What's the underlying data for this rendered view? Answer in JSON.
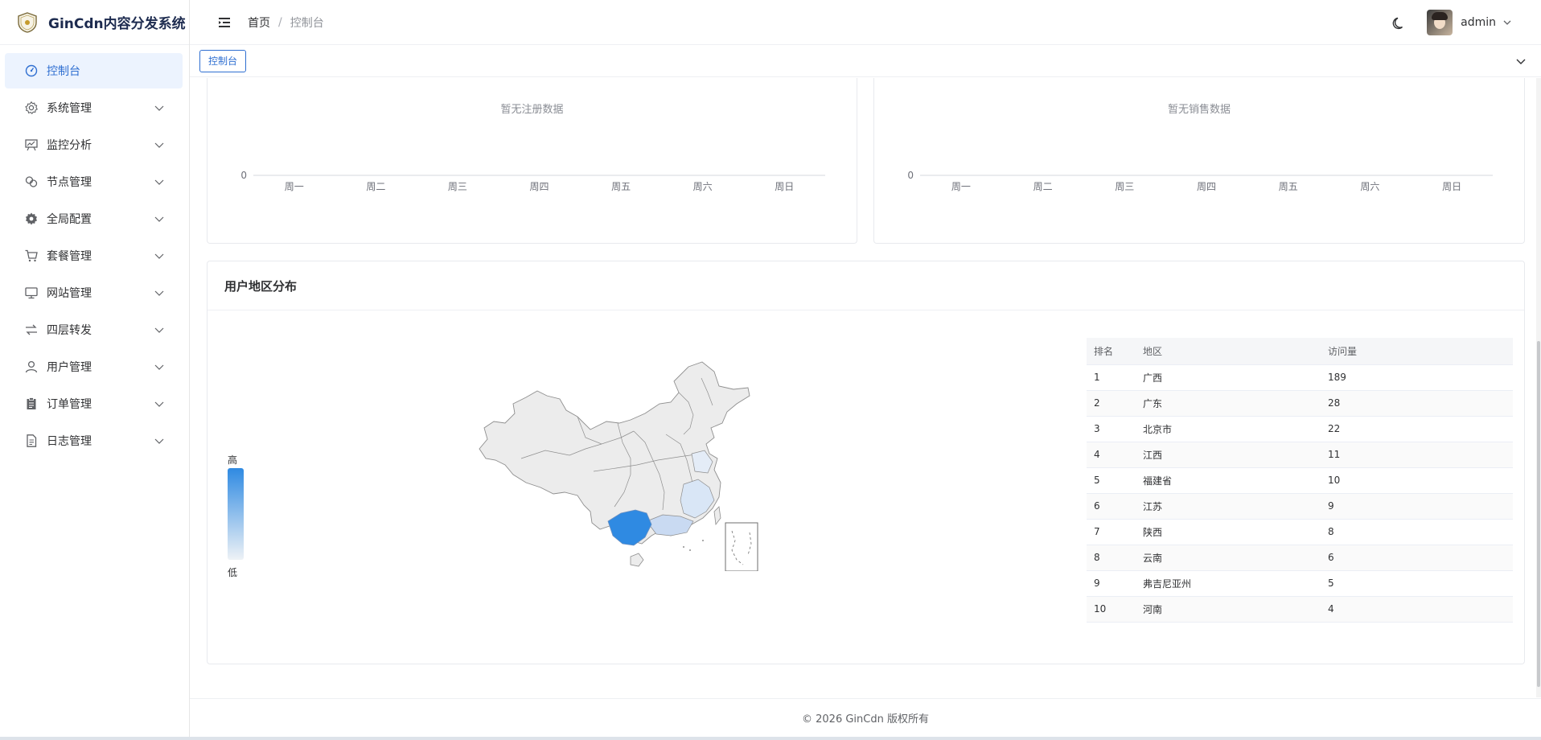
{
  "app": {
    "title": "GinCdn内容分发系统"
  },
  "sidebar": {
    "items": [
      {
        "label": "控制台",
        "icon": "dashboard-icon",
        "active": true
      },
      {
        "label": "系统管理",
        "icon": "gear-icon"
      },
      {
        "label": "监控分析",
        "icon": "presentation-chart-icon"
      },
      {
        "label": "节点管理",
        "icon": "link-icon"
      },
      {
        "label": "全局配置",
        "icon": "gear-filled-icon"
      },
      {
        "label": "套餐管理",
        "icon": "cart-icon"
      },
      {
        "label": "网站管理",
        "icon": "monitor-icon"
      },
      {
        "label": "四层转发",
        "icon": "switch-arrows-icon"
      },
      {
        "label": "用户管理",
        "icon": "user-icon"
      },
      {
        "label": "订单管理",
        "icon": "clipboard-icon"
      },
      {
        "label": "日志管理",
        "icon": "document-icon"
      }
    ]
  },
  "header": {
    "breadcrumb": {
      "home": "首页",
      "separator": "/",
      "current": "控制台"
    },
    "user": {
      "name": "admin"
    }
  },
  "tags": {
    "active": "控制台"
  },
  "charts": {
    "register": {
      "empty_text": "暂无注册数据"
    },
    "sales": {
      "empty_text": "暂无销售数据"
    }
  },
  "chart_data": [
    {
      "type": "line",
      "title": "暂无注册数据",
      "categories": [
        "周一",
        "周二",
        "周三",
        "周四",
        "周五",
        "周六",
        "周日"
      ],
      "yticks": [
        "0"
      ],
      "values": []
    },
    {
      "type": "line",
      "title": "暂无销售数据",
      "categories": [
        "周一",
        "周二",
        "周三",
        "周四",
        "周五",
        "周六",
        "周日"
      ],
      "yticks": [
        "0"
      ],
      "values": []
    }
  ],
  "map_section": {
    "title": "用户地区分布",
    "legend": {
      "high": "高",
      "low": "低"
    },
    "columns": [
      "排名",
      "地区",
      "访问量"
    ],
    "rows": [
      [
        "1",
        "广西",
        "189"
      ],
      [
        "2",
        "广东",
        "28"
      ],
      [
        "3",
        "北京市",
        "22"
      ],
      [
        "4",
        "江西",
        "11"
      ],
      [
        "5",
        "福建省",
        "10"
      ],
      [
        "6",
        "江苏",
        "9"
      ],
      [
        "7",
        "陕西",
        "8"
      ],
      [
        "8",
        "云南",
        "6"
      ],
      [
        "9",
        "弗吉尼亚州",
        "5"
      ],
      [
        "10",
        "河南",
        "4"
      ]
    ]
  },
  "footer": {
    "text": "© 2026 GinCdn 版权所有"
  },
  "colors": {
    "accent": "#2f6fd1",
    "map_high": "#2f8ae2",
    "map_low": "#eef2f6"
  }
}
